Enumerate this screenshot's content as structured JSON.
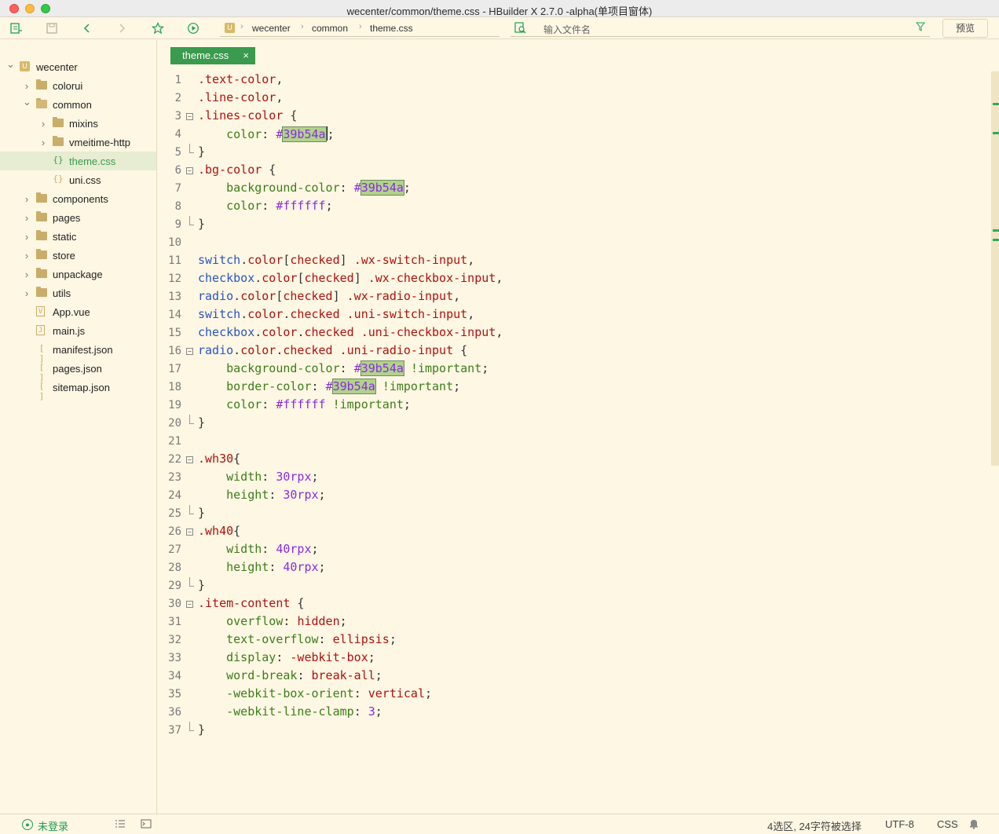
{
  "window": {
    "title": "wecenter/common/theme.css - HBuilder X 2.7.0 -alpha(单项目窗体)"
  },
  "toolbar": {
    "breadcrumb": [
      "wecenter",
      "common",
      "theme.css"
    ],
    "search_placeholder": "输入文件名",
    "preview_label": "预览",
    "icons": [
      "new-file-icon",
      "save-icon",
      "back-icon",
      "forward-icon",
      "star-icon",
      "run-icon",
      "search-file-icon",
      "filter-icon"
    ]
  },
  "sidebar": {
    "items": [
      {
        "label": "wecenter",
        "type": "project",
        "depth": 0,
        "expanded": true
      },
      {
        "label": "colorui",
        "type": "folder",
        "depth": 1,
        "expanded": false
      },
      {
        "label": "common",
        "type": "folder",
        "depth": 1,
        "expanded": true
      },
      {
        "label": "mixins",
        "type": "folder",
        "depth": 2,
        "expanded": false
      },
      {
        "label": "vmeitime-http",
        "type": "folder",
        "depth": 2,
        "expanded": false
      },
      {
        "label": "theme.css",
        "type": "css",
        "depth": 2,
        "selected": true
      },
      {
        "label": "uni.css",
        "type": "css",
        "depth": 2
      },
      {
        "label": "components",
        "type": "folder",
        "depth": 1,
        "expanded": false
      },
      {
        "label": "pages",
        "type": "folder",
        "depth": 1,
        "expanded": false
      },
      {
        "label": "static",
        "type": "folder",
        "depth": 1,
        "expanded": false
      },
      {
        "label": "store",
        "type": "folder",
        "depth": 1,
        "expanded": false
      },
      {
        "label": "unpackage",
        "type": "folder",
        "depth": 1,
        "expanded": false
      },
      {
        "label": "utils",
        "type": "folder",
        "depth": 1,
        "expanded": false
      },
      {
        "label": "App.vue",
        "type": "vue",
        "depth": 1
      },
      {
        "label": "main.js",
        "type": "js",
        "depth": 1
      },
      {
        "label": "manifest.json",
        "type": "json",
        "depth": 1
      },
      {
        "label": "pages.json",
        "type": "json",
        "depth": 1
      },
      {
        "label": "sitemap.json",
        "type": "json",
        "depth": 1
      }
    ]
  },
  "editor": {
    "tab_label": "theme.css",
    "tab_close": "×",
    "lines": [
      {
        "n": "1",
        "fold": "",
        "tokens": [
          [
            "sel",
            ".text-color"
          ],
          [
            "punc",
            ","
          ]
        ]
      },
      {
        "n": "2",
        "fold": "",
        "tokens": [
          [
            "sel",
            ".line-color"
          ],
          [
            "punc",
            ","
          ]
        ]
      },
      {
        "n": "3",
        "fold": "start",
        "tokens": [
          [
            "sel",
            ".lines-color"
          ],
          [
            "punc",
            " {"
          ]
        ]
      },
      {
        "n": "4",
        "fold": "",
        "tokens": [
          [
            "punc",
            "    "
          ],
          [
            "prop",
            "color"
          ],
          [
            "punc",
            ": "
          ],
          [
            "num",
            "#"
          ],
          [
            "hex",
            "39b54a"
          ],
          [
            "cursor",
            ""
          ],
          [
            "punc",
            ";"
          ]
        ]
      },
      {
        "n": "5",
        "fold": "end",
        "tokens": [
          [
            "punc",
            "}"
          ]
        ]
      },
      {
        "n": "6",
        "fold": "start",
        "tokens": [
          [
            "sel",
            ".bg-color"
          ],
          [
            "punc",
            " {"
          ]
        ]
      },
      {
        "n": "7",
        "fold": "",
        "tokens": [
          [
            "punc",
            "    "
          ],
          [
            "prop",
            "background-color"
          ],
          [
            "punc",
            ": "
          ],
          [
            "num",
            "#"
          ],
          [
            "hex",
            "39b54a"
          ],
          [
            "punc",
            ";"
          ]
        ]
      },
      {
        "n": "8",
        "fold": "",
        "tokens": [
          [
            "punc",
            "    "
          ],
          [
            "prop",
            "color"
          ],
          [
            "punc",
            ": "
          ],
          [
            "num",
            "#ffffff"
          ],
          [
            "punc",
            ";"
          ]
        ]
      },
      {
        "n": "9",
        "fold": "end",
        "tokens": [
          [
            "punc",
            "}"
          ]
        ]
      },
      {
        "n": "10",
        "fold": "",
        "tokens": []
      },
      {
        "n": "11",
        "fold": "",
        "tokens": [
          [
            "tag",
            "switch"
          ],
          [
            "punc",
            "."
          ],
          [
            "kw",
            "color"
          ],
          [
            "punc",
            "["
          ],
          [
            "kw",
            "checked"
          ],
          [
            "punc",
            "] "
          ],
          [
            "sel",
            ".wx-switch-input"
          ],
          [
            "punc",
            ","
          ]
        ]
      },
      {
        "n": "12",
        "fold": "",
        "tokens": [
          [
            "tag",
            "checkbox"
          ],
          [
            "punc",
            "."
          ],
          [
            "kw",
            "color"
          ],
          [
            "punc",
            "["
          ],
          [
            "kw",
            "checked"
          ],
          [
            "punc",
            "] "
          ],
          [
            "sel",
            ".wx-checkbox-input"
          ],
          [
            "punc",
            ","
          ]
        ]
      },
      {
        "n": "13",
        "fold": "",
        "tokens": [
          [
            "tag",
            "radio"
          ],
          [
            "punc",
            "."
          ],
          [
            "kw",
            "color"
          ],
          [
            "punc",
            "["
          ],
          [
            "kw",
            "checked"
          ],
          [
            "punc",
            "] "
          ],
          [
            "sel",
            ".wx-radio-input"
          ],
          [
            "punc",
            ","
          ]
        ]
      },
      {
        "n": "14",
        "fold": "",
        "tokens": [
          [
            "tag",
            "switch"
          ],
          [
            "punc",
            "."
          ],
          [
            "kw",
            "color"
          ],
          [
            "punc",
            "."
          ],
          [
            "kw",
            "checked"
          ],
          [
            "punc",
            " "
          ],
          [
            "sel",
            ".uni-switch-input"
          ],
          [
            "punc",
            ","
          ]
        ]
      },
      {
        "n": "15",
        "fold": "",
        "tokens": [
          [
            "tag",
            "checkbox"
          ],
          [
            "punc",
            "."
          ],
          [
            "kw",
            "color"
          ],
          [
            "punc",
            "."
          ],
          [
            "kw",
            "checked"
          ],
          [
            "punc",
            " "
          ],
          [
            "sel",
            ".uni-checkbox-input"
          ],
          [
            "punc",
            ","
          ]
        ]
      },
      {
        "n": "16",
        "fold": "start",
        "tokens": [
          [
            "tag",
            "radio"
          ],
          [
            "punc",
            "."
          ],
          [
            "kw",
            "color"
          ],
          [
            "punc",
            "."
          ],
          [
            "kw",
            "checked"
          ],
          [
            "punc",
            " "
          ],
          [
            "sel",
            ".uni-radio-input"
          ],
          [
            "punc",
            " {"
          ]
        ]
      },
      {
        "n": "17",
        "fold": "",
        "tokens": [
          [
            "punc",
            "    "
          ],
          [
            "prop",
            "background-color"
          ],
          [
            "punc",
            ": "
          ],
          [
            "num",
            "#"
          ],
          [
            "hex",
            "39b54a"
          ],
          [
            "punc",
            " "
          ],
          [
            "prop",
            "!important"
          ],
          [
            "punc",
            ";"
          ]
        ]
      },
      {
        "n": "18",
        "fold": "",
        "tokens": [
          [
            "punc",
            "    "
          ],
          [
            "prop",
            "border-color"
          ],
          [
            "punc",
            ": "
          ],
          [
            "num",
            "#"
          ],
          [
            "hex",
            "39b54a"
          ],
          [
            "punc",
            " "
          ],
          [
            "prop",
            "!important"
          ],
          [
            "punc",
            ";"
          ]
        ]
      },
      {
        "n": "19",
        "fold": "",
        "tokens": [
          [
            "punc",
            "    "
          ],
          [
            "prop",
            "color"
          ],
          [
            "punc",
            ": "
          ],
          [
            "num",
            "#ffffff"
          ],
          [
            "punc",
            " "
          ],
          [
            "prop",
            "!important"
          ],
          [
            "punc",
            ";"
          ]
        ]
      },
      {
        "n": "20",
        "fold": "end",
        "tokens": [
          [
            "punc",
            "}"
          ]
        ]
      },
      {
        "n": "21",
        "fold": "",
        "tokens": []
      },
      {
        "n": "22",
        "fold": "start",
        "tokens": [
          [
            "sel",
            ".wh30"
          ],
          [
            "punc",
            "{"
          ]
        ]
      },
      {
        "n": "23",
        "fold": "",
        "tokens": [
          [
            "punc",
            "    "
          ],
          [
            "prop",
            "width"
          ],
          [
            "punc",
            ": "
          ],
          [
            "num",
            "30rpx"
          ],
          [
            "punc",
            ";"
          ]
        ]
      },
      {
        "n": "24",
        "fold": "",
        "tokens": [
          [
            "punc",
            "    "
          ],
          [
            "prop",
            "height"
          ],
          [
            "punc",
            ": "
          ],
          [
            "num",
            "30rpx"
          ],
          [
            "punc",
            ";"
          ]
        ]
      },
      {
        "n": "25",
        "fold": "end",
        "tokens": [
          [
            "punc",
            "}"
          ]
        ]
      },
      {
        "n": "26",
        "fold": "start",
        "tokens": [
          [
            "sel",
            ".wh40"
          ],
          [
            "punc",
            "{"
          ]
        ]
      },
      {
        "n": "27",
        "fold": "",
        "tokens": [
          [
            "punc",
            "    "
          ],
          [
            "prop",
            "width"
          ],
          [
            "punc",
            ": "
          ],
          [
            "num",
            "40rpx"
          ],
          [
            "punc",
            ";"
          ]
        ]
      },
      {
        "n": "28",
        "fold": "",
        "tokens": [
          [
            "punc",
            "    "
          ],
          [
            "prop",
            "height"
          ],
          [
            "punc",
            ": "
          ],
          [
            "num",
            "40rpx"
          ],
          [
            "punc",
            ";"
          ]
        ]
      },
      {
        "n": "29",
        "fold": "end",
        "tokens": [
          [
            "punc",
            "}"
          ]
        ]
      },
      {
        "n": "30",
        "fold": "start",
        "tokens": [
          [
            "sel",
            ".item-content"
          ],
          [
            "punc",
            " {"
          ]
        ]
      },
      {
        "n": "31",
        "fold": "",
        "tokens": [
          [
            "punc",
            "    "
          ],
          [
            "prop",
            "overflow"
          ],
          [
            "punc",
            ": "
          ],
          [
            "kw",
            "hidden"
          ],
          [
            "punc",
            ";"
          ]
        ]
      },
      {
        "n": "32",
        "fold": "",
        "tokens": [
          [
            "punc",
            "    "
          ],
          [
            "prop",
            "text-overflow"
          ],
          [
            "punc",
            ": "
          ],
          [
            "kw",
            "ellipsis"
          ],
          [
            "punc",
            ";"
          ]
        ]
      },
      {
        "n": "33",
        "fold": "",
        "tokens": [
          [
            "punc",
            "    "
          ],
          [
            "prop",
            "display"
          ],
          [
            "punc",
            ": "
          ],
          [
            "kw",
            "-webkit-box"
          ],
          [
            "punc",
            ";"
          ]
        ]
      },
      {
        "n": "34",
        "fold": "",
        "tokens": [
          [
            "punc",
            "    "
          ],
          [
            "prop",
            "word-break"
          ],
          [
            "punc",
            ": "
          ],
          [
            "kw",
            "break-all"
          ],
          [
            "punc",
            ";"
          ]
        ]
      },
      {
        "n": "35",
        "fold": "",
        "tokens": [
          [
            "punc",
            "    "
          ],
          [
            "prop",
            "-webkit-box-orient"
          ],
          [
            "punc",
            ": "
          ],
          [
            "kw",
            "vertical"
          ],
          [
            "punc",
            ";"
          ]
        ]
      },
      {
        "n": "36",
        "fold": "",
        "tokens": [
          [
            "punc",
            "    "
          ],
          [
            "prop",
            "-webkit-line-clamp"
          ],
          [
            "punc",
            ": "
          ],
          [
            "num",
            "3"
          ],
          [
            "punc",
            ";"
          ]
        ]
      },
      {
        "n": "37",
        "fold": "end",
        "tokens": [
          [
            "punc",
            "}"
          ]
        ]
      }
    ]
  },
  "statusbar": {
    "login_label": "未登录",
    "selection": "4选区, 24字符被选择",
    "encoding": "UTF-8",
    "language": "CSS"
  },
  "colors": {
    "accent": "#3a9a4d",
    "background": "#fdf7e3",
    "selector": "#b01010",
    "property": "#3d7d1b",
    "value": "#8a2be2",
    "tag": "#2a55c2"
  }
}
